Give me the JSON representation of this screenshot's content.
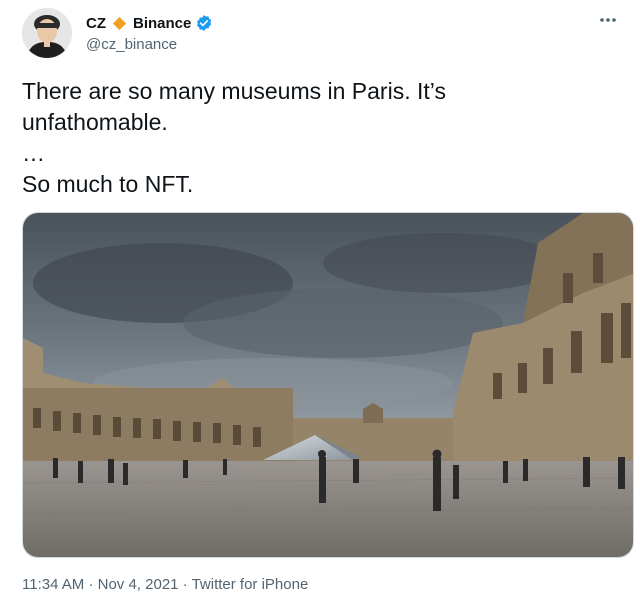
{
  "tweet": {
    "author": {
      "display_name_prefix": "CZ",
      "display_name_suffix": "Binance",
      "handle": "@cz_binance",
      "badge_color": "#f0a123",
      "verified_color": "#1d9bf0",
      "avatar_icon": "avatar-portrait",
      "badge_icon": "binance-diamond-icon",
      "verified_icon": "verified-badge-icon"
    },
    "more_icon": "more-options-icon",
    "text": "There are so many museums in Paris. It’s\nunfathomable.\n…\nSo much to NFT.",
    "media": {
      "type": "photo"
    },
    "time": "11:34 AM",
    "date": "Nov 4, 2021",
    "source": "Twitter for iPhone",
    "separator": "·"
  }
}
